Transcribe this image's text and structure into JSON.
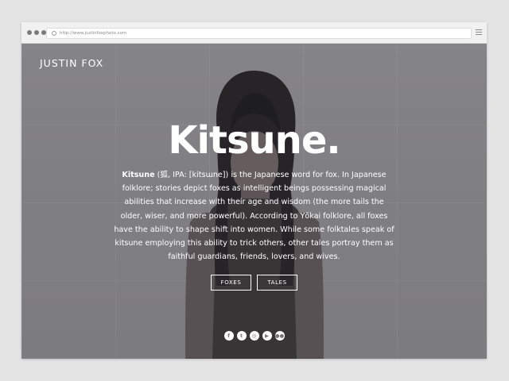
{
  "browser": {
    "url": "http://www.justinfoxphoto.com"
  },
  "header": {
    "brand": "JUSTIN FOX"
  },
  "hero": {
    "title": "Kitsune.",
    "description": {
      "term": "Kitsune",
      "text": " (狐, IPA: [kitsɯne]) is the Japanese word for fox. In Japanese folklore; stories depict foxes as intelligent beings possessing magical abilities that increase with their age and wisdom (the more tails the older, wiser, and more powerful). According to Yōkai folklore, all foxes have the ability to shape shift into women. While some folktales speak of kitsune employing this ability to trick others, other tales portray them as faithful guardians, friends, lovers, and wives."
    }
  },
  "buttons": {
    "foxes": "FOXES",
    "tales": "TALES"
  },
  "social": [
    {
      "icon": "facebook-icon",
      "glyph": "f"
    },
    {
      "icon": "tumblr-icon",
      "glyph": "t"
    },
    {
      "icon": "instagram-icon",
      "glyph": "◎"
    },
    {
      "icon": "youtube-icon",
      "glyph": "▶"
    },
    {
      "icon": "flickr-icon",
      "glyph": "●●"
    }
  ]
}
